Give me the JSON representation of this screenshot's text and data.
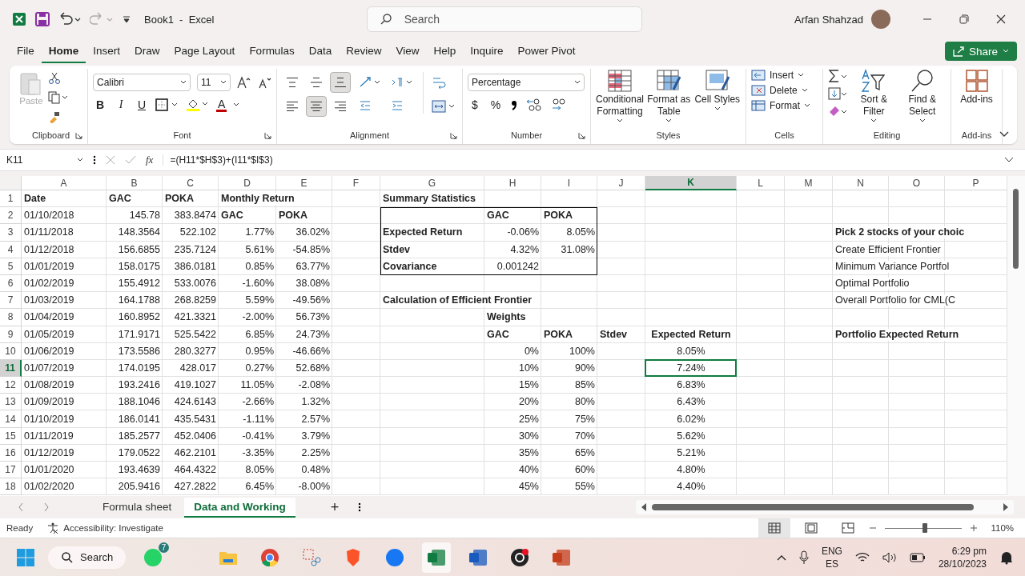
{
  "title_bar": {
    "title": "Book1  -  Excel",
    "search_placeholder": "Search",
    "user": "Arfan Shahzad"
  },
  "menu": [
    {
      "label": "File",
      "selected": false
    },
    {
      "label": "Home",
      "selected": true
    },
    {
      "label": "Insert",
      "selected": false
    },
    {
      "label": "Draw",
      "selected": false
    },
    {
      "label": "Page Layout",
      "selected": false
    },
    {
      "label": "Formulas",
      "selected": false
    },
    {
      "label": "Data",
      "selected": false
    },
    {
      "label": "Review",
      "selected": false
    },
    {
      "label": "View",
      "selected": false
    },
    {
      "label": "Help",
      "selected": false
    },
    {
      "label": "Inquire",
      "selected": false
    },
    {
      "label": "Power Pivot",
      "selected": false
    }
  ],
  "share": {
    "label": "Share"
  },
  "ribbon": {
    "clipboard": {
      "label": "Clipboard",
      "paste": {
        "label": "Paste",
        "disabled": true
      }
    },
    "font": {
      "label": "Font",
      "font_name": "Calibri",
      "font_size": "11",
      "bold": "B",
      "italic": "I",
      "underline": "U",
      "font_color_letter": "A"
    },
    "alignment": {
      "label": "Alignment",
      "buttons": [
        {
          "kind": "top",
          "selected": false
        },
        {
          "kind": "middle",
          "selected": false
        },
        {
          "kind": "bottom",
          "selected": true
        },
        {
          "kind": "left",
          "selected": false
        },
        {
          "kind": "center",
          "selected": true
        },
        {
          "kind": "right",
          "selected": false
        }
      ]
    },
    "number": {
      "label": "Number",
      "format": "Percentage",
      "currency": "$",
      "percent": "%"
    },
    "styles": {
      "label": "Styles",
      "buttons": [
        {
          "kind": "conditional",
          "label": "Conditional Formatting"
        },
        {
          "kind": "table",
          "label": "Format as Table"
        },
        {
          "kind": "cellstyles",
          "label": "Cell Styles"
        }
      ]
    },
    "cells": {
      "label": "Cells",
      "buttons": [
        {
          "kind": "insert",
          "label": "Insert"
        },
        {
          "kind": "delete",
          "label": "Delete"
        },
        {
          "kind": "format",
          "label": "Format"
        }
      ]
    },
    "editing": {
      "label": "Editing",
      "buttons": [
        {
          "kind": "sort",
          "label": "Sort & Filter"
        },
        {
          "kind": "find",
          "label": "Find & Select"
        }
      ]
    },
    "addins": {
      "label": "Add-ins",
      "button": "Add-ins"
    }
  },
  "formula_bar": {
    "name_box": "K11",
    "function_symbol": "fx",
    "formula": "=(H11*$H$3)+(I11*$I$3)"
  },
  "sheet": {
    "columns": [
      {
        "label": "A",
        "selected": false
      },
      {
        "label": "B",
        "selected": false
      },
      {
        "label": "C",
        "selected": false
      },
      {
        "label": "D",
        "selected": false
      },
      {
        "label": "E",
        "selected": false
      },
      {
        "label": "F",
        "selected": false
      },
      {
        "label": "G",
        "selected": false
      },
      {
        "label": "H",
        "selected": false
      },
      {
        "label": "I",
        "selected": false
      },
      {
        "label": "J",
        "selected": false
      },
      {
        "label": "K",
        "selected": true
      },
      {
        "label": "L",
        "selected": false
      },
      {
        "label": "M",
        "selected": false
      },
      {
        "label": "N",
        "selected": false
      },
      {
        "label": "O",
        "selected": false
      },
      {
        "label": "P",
        "selected": false
      }
    ],
    "rows": [
      {
        "number": "1",
        "selected": false,
        "cells": {
          "A": {
            "text": "Date",
            "bold": true,
            "kind": "text"
          },
          "B": {
            "text": "GAC",
            "bold": true,
            "kind": "text"
          },
          "C": {
            "text": "POKA",
            "bold": true,
            "kind": "text"
          },
          "D": {
            "text": "Monthly Return",
            "bold": true,
            "kind": "text"
          },
          "G": {
            "text": "Summary Statistics",
            "bold": true,
            "kind": "text"
          }
        }
      },
      {
        "number": "2",
        "selected": false,
        "cells": {
          "A": {
            "text": "01/10/2018",
            "bold": false,
            "kind": "text"
          },
          "B": {
            "text": "145.78",
            "bold": false,
            "kind": "number"
          },
          "C": {
            "text": "383.8474",
            "bold": false,
            "kind": "number"
          },
          "D": {
            "text": "GAC",
            "bold": true,
            "kind": "text"
          },
          "E": {
            "text": "POKA",
            "bold": true,
            "kind": "text"
          },
          "G": {
            "borders": {
              "top": true,
              "left": true
            }
          },
          "H": {
            "text": "GAC",
            "bold": true,
            "kind": "text",
            "borders": {
              "top": true
            }
          },
          "I": {
            "text": "POKA",
            "bold": true,
            "kind": "text",
            "borders": {
              "top": true,
              "right": true
            }
          }
        }
      },
      {
        "number": "3",
        "selected": false,
        "cells": {
          "A": {
            "text": "01/11/2018",
            "bold": false,
            "kind": "text"
          },
          "B": {
            "text": "148.3564",
            "bold": false,
            "kind": "number"
          },
          "C": {
            "text": "522.102",
            "bold": false,
            "kind": "number"
          },
          "D": {
            "text": "1.77%",
            "bold": false,
            "kind": "number"
          },
          "E": {
            "text": "36.02%",
            "bold": false,
            "kind": "number"
          },
          "G": {
            "text": "Expected Return",
            "bold": true,
            "kind": "text",
            "borders": {
              "left": true
            }
          },
          "H": {
            "text": "-0.06%",
            "bold": false,
            "kind": "number"
          },
          "I": {
            "text": "8.05%",
            "bold": false,
            "kind": "number",
            "borders": {
              "right": true
            }
          },
          "N": {
            "text": "Pick 2 stocks of your choic",
            "bold": true,
            "kind": "text"
          }
        }
      },
      {
        "number": "4",
        "selected": false,
        "cells": {
          "A": {
            "text": "01/12/2018",
            "bold": false,
            "kind": "text"
          },
          "B": {
            "text": "156.6855",
            "bold": false,
            "kind": "number"
          },
          "C": {
            "text": "235.7124",
            "bold": false,
            "kind": "number"
          },
          "D": {
            "text": "5.61%",
            "bold": false,
            "kind": "number"
          },
          "E": {
            "text": "-54.85%",
            "bold": false,
            "kind": "number"
          },
          "G": {
            "text": "Stdev",
            "bold": true,
            "kind": "text",
            "borders": {
              "left": true
            }
          },
          "H": {
            "text": "4.32%",
            "bold": false,
            "kind": "number"
          },
          "I": {
            "text": "31.08%",
            "bold": false,
            "kind": "number",
            "borders": {
              "right": true
            }
          },
          "N": {
            "text": "Create Efficient Frontier",
            "bold": false,
            "kind": "text"
          }
        }
      },
      {
        "number": "5",
        "selected": false,
        "cells": {
          "A": {
            "text": "01/01/2019",
            "bold": false,
            "kind": "text"
          },
          "B": {
            "text": "158.0175",
            "bold": false,
            "kind": "number"
          },
          "C": {
            "text": "386.0181",
            "bold": false,
            "kind": "number"
          },
          "D": {
            "text": "0.85%",
            "bold": false,
            "kind": "number"
          },
          "E": {
            "text": "63.77%",
            "bold": false,
            "kind": "number"
          },
          "G": {
            "text": "Covariance",
            "bold": true,
            "kind": "text",
            "borders": {
              "bottom": true,
              "left": true
            }
          },
          "H": {
            "text": "0.001242",
            "bold": false,
            "kind": "number",
            "borders": {
              "bottom": true
            }
          },
          "I": {
            "borders": {
              "bottom": true,
              "right": true
            }
          },
          "N": {
            "text": "Minimum Variance Portfol",
            "bold": false,
            "kind": "text"
          }
        }
      },
      {
        "number": "6",
        "selected": false,
        "cells": {
          "A": {
            "text": "01/02/2019",
            "bold": false,
            "kind": "text"
          },
          "B": {
            "text": "155.4912",
            "bold": false,
            "kind": "number"
          },
          "C": {
            "text": "533.0076",
            "bold": false,
            "kind": "number"
          },
          "D": {
            "text": "-1.60%",
            "bold": false,
            "kind": "number"
          },
          "E": {
            "text": "38.08%",
            "bold": false,
            "kind": "number"
          },
          "N": {
            "text": "Optimal Portfolio",
            "bold": false,
            "kind": "text"
          }
        }
      },
      {
        "number": "7",
        "selected": false,
        "cells": {
          "A": {
            "text": "01/03/2019",
            "bold": false,
            "kind": "text"
          },
          "B": {
            "text": "164.1788",
            "bold": false,
            "kind": "number"
          },
          "C": {
            "text": "268.8259",
            "bold": false,
            "kind": "number"
          },
          "D": {
            "text": "5.59%",
            "bold": false,
            "kind": "number"
          },
          "E": {
            "text": "-49.56%",
            "bold": false,
            "kind": "number"
          },
          "G": {
            "text": "Calculation of Efficient Frontier",
            "bold": true,
            "kind": "text"
          },
          "N": {
            "text": "Overall Portfolio for CML(C",
            "bold": false,
            "kind": "text"
          }
        }
      },
      {
        "number": "8",
        "selected": false,
        "cells": {
          "A": {
            "text": "01/04/2019",
            "bold": false,
            "kind": "text"
          },
          "B": {
            "text": "160.8952",
            "bold": false,
            "kind": "number"
          },
          "C": {
            "text": "421.3321",
            "bold": false,
            "kind": "number"
          },
          "D": {
            "text": "-2.00%",
            "bold": false,
            "kind": "number"
          },
          "E": {
            "text": "56.73%",
            "bold": false,
            "kind": "number"
          },
          "H": {
            "text": "Weights",
            "bold": true,
            "kind": "text"
          }
        }
      },
      {
        "number": "9",
        "selected": false,
        "cells": {
          "A": {
            "text": "01/05/2019",
            "bold": false,
            "kind": "text"
          },
          "B": {
            "text": "171.9171",
            "bold": false,
            "kind": "number"
          },
          "C": {
            "text": "525.5422",
            "bold": false,
            "kind": "number"
          },
          "D": {
            "text": "6.85%",
            "bold": false,
            "kind": "number"
          },
          "E": {
            "text": "24.73%",
            "bold": false,
            "kind": "number"
          },
          "H": {
            "text": "GAC",
            "bold": true,
            "kind": "text"
          },
          "I": {
            "text": "POKA",
            "bold": true,
            "kind": "text"
          },
          "J": {
            "text": "Stdev",
            "bold": true,
            "kind": "text"
          },
          "K": {
            "text": "Expected Return",
            "bold": true,
            "kind": "centered"
          },
          "N": {
            "text": "Portfolio Expected Return",
            "bold": true,
            "kind": "text"
          }
        }
      },
      {
        "number": "10",
        "selected": false,
        "cells": {
          "A": {
            "text": "01/06/2019",
            "bold": false,
            "kind": "text"
          },
          "B": {
            "text": "173.5586",
            "bold": false,
            "kind": "number"
          },
          "C": {
            "text": "280.3277",
            "bold": false,
            "kind": "number"
          },
          "D": {
            "text": "0.95%",
            "bold": false,
            "kind": "number"
          },
          "E": {
            "text": "-46.66%",
            "bold": false,
            "kind": "number"
          },
          "H": {
            "text": "0%",
            "bold": false,
            "kind": "number"
          },
          "I": {
            "text": "100%",
            "bold": false,
            "kind": "number"
          },
          "K": {
            "text": "8.05%",
            "bold": false,
            "kind": "centered"
          }
        }
      },
      {
        "number": "11",
        "selected": true,
        "cells": {
          "A": {
            "text": "01/07/2019",
            "bold": false,
            "kind": "text"
          },
          "B": {
            "text": "174.0195",
            "bold": false,
            "kind": "number"
          },
          "C": {
            "text": "428.017",
            "bold": false,
            "kind": "number"
          },
          "D": {
            "text": "0.27%",
            "bold": false,
            "kind": "number"
          },
          "E": {
            "text": "52.68%",
            "bold": false,
            "kind": "number"
          },
          "H": {
            "text": "10%",
            "bold": false,
            "kind": "number"
          },
          "I": {
            "text": "90%",
            "bold": false,
            "kind": "number"
          },
          "K": {
            "text": "7.24%",
            "bold": false,
            "kind": "centered"
          }
        }
      },
      {
        "number": "12",
        "selected": false,
        "cells": {
          "A": {
            "text": "01/08/2019",
            "bold": false,
            "kind": "text"
          },
          "B": {
            "text": "193.2416",
            "bold": false,
            "kind": "number"
          },
          "C": {
            "text": "419.1027",
            "bold": false,
            "kind": "number"
          },
          "D": {
            "text": "11.05%",
            "bold": false,
            "kind": "number"
          },
          "E": {
            "text": "-2.08%",
            "bold": false,
            "kind": "number"
          },
          "H": {
            "text": "15%",
            "bold": false,
            "kind": "number"
          },
          "I": {
            "text": "85%",
            "bold": false,
            "kind": "number"
          },
          "K": {
            "text": "6.83%",
            "bold": false,
            "kind": "centered"
          }
        }
      },
      {
        "number": "13",
        "selected": false,
        "cells": {
          "A": {
            "text": "01/09/2019",
            "bold": false,
            "kind": "text"
          },
          "B": {
            "text": "188.1046",
            "bold": false,
            "kind": "number"
          },
          "C": {
            "text": "424.6143",
            "bold": false,
            "kind": "number"
          },
          "D": {
            "text": "-2.66%",
            "bold": false,
            "kind": "number"
          },
          "E": {
            "text": "1.32%",
            "bold": false,
            "kind": "number"
          },
          "H": {
            "text": "20%",
            "bold": false,
            "kind": "number"
          },
          "I": {
            "text": "80%",
            "bold": false,
            "kind": "number"
          },
          "K": {
            "text": "6.43%",
            "bold": false,
            "kind": "centered"
          }
        }
      },
      {
        "number": "14",
        "selected": false,
        "cells": {
          "A": {
            "text": "01/10/2019",
            "bold": false,
            "kind": "text"
          },
          "B": {
            "text": "186.0141",
            "bold": false,
            "kind": "number"
          },
          "C": {
            "text": "435.5431",
            "bold": false,
            "kind": "number"
          },
          "D": {
            "text": "-1.11%",
            "bold": false,
            "kind": "number"
          },
          "E": {
            "text": "2.57%",
            "bold": false,
            "kind": "number"
          },
          "H": {
            "text": "25%",
            "bold": false,
            "kind": "number"
          },
          "I": {
            "text": "75%",
            "bold": false,
            "kind": "number"
          },
          "K": {
            "text": "6.02%",
            "bold": false,
            "kind": "centered"
          }
        }
      },
      {
        "number": "15",
        "selected": false,
        "cells": {
          "A": {
            "text": "01/11/2019",
            "bold": false,
            "kind": "text"
          },
          "B": {
            "text": "185.2577",
            "bold": false,
            "kind": "number"
          },
          "C": {
            "text": "452.0406",
            "bold": false,
            "kind": "number"
          },
          "D": {
            "text": "-0.41%",
            "bold": false,
            "kind": "number"
          },
          "E": {
            "text": "3.79%",
            "bold": false,
            "kind": "number"
          },
          "H": {
            "text": "30%",
            "bold": false,
            "kind": "number"
          },
          "I": {
            "text": "70%",
            "bold": false,
            "kind": "number"
          },
          "K": {
            "text": "5.62%",
            "bold": false,
            "kind": "centered"
          }
        }
      },
      {
        "number": "16",
        "selected": false,
        "cells": {
          "A": {
            "text": "01/12/2019",
            "bold": false,
            "kind": "text"
          },
          "B": {
            "text": "179.0522",
            "bold": false,
            "kind": "number"
          },
          "C": {
            "text": "462.2101",
            "bold": false,
            "kind": "number"
          },
          "D": {
            "text": "-3.35%",
            "bold": false,
            "kind": "number"
          },
          "E": {
            "text": "2.25%",
            "bold": false,
            "kind": "number"
          },
          "H": {
            "text": "35%",
            "bold": false,
            "kind": "number"
          },
          "I": {
            "text": "65%",
            "bold": false,
            "kind": "number"
          },
          "K": {
            "text": "5.21%",
            "bold": false,
            "kind": "centered"
          }
        }
      },
      {
        "number": "17",
        "selected": false,
        "cells": {
          "A": {
            "text": "01/01/2020",
            "bold": false,
            "kind": "text"
          },
          "B": {
            "text": "193.4639",
            "bold": false,
            "kind": "number"
          },
          "C": {
            "text": "464.4322",
            "bold": false,
            "kind": "number"
          },
          "D": {
            "text": "8.05%",
            "bold": false,
            "kind": "number"
          },
          "E": {
            "text": "0.48%",
            "bold": false,
            "kind": "number"
          },
          "H": {
            "text": "40%",
            "bold": false,
            "kind": "number"
          },
          "I": {
            "text": "60%",
            "bold": false,
            "kind": "number"
          },
          "K": {
            "text": "4.80%",
            "bold": false,
            "kind": "centered"
          }
        }
      },
      {
        "number": "18",
        "selected": false,
        "cells": {
          "A": {
            "text": "01/02/2020",
            "bold": false,
            "kind": "text"
          },
          "B": {
            "text": "205.9416",
            "bold": false,
            "kind": "number"
          },
          "C": {
            "text": "427.2822",
            "bold": false,
            "kind": "number"
          },
          "D": {
            "text": "6.45%",
            "bold": false,
            "kind": "number"
          },
          "E": {
            "text": "-8.00%",
            "bold": false,
            "kind": "number"
          },
          "H": {
            "text": "45%",
            "bold": false,
            "kind": "number"
          },
          "I": {
            "text": "55%",
            "bold": false,
            "kind": "number"
          },
          "K": {
            "text": "4.40%",
            "bold": false,
            "kind": "centered"
          }
        }
      }
    ]
  },
  "sheet_tabs": [
    {
      "label": "Formula sheet",
      "selected": false
    },
    {
      "label": "Data and Working",
      "selected": true
    }
  ],
  "add_sheet": "+",
  "status_bar": {
    "ready": "Ready",
    "accessibility": "Accessibility: Investigate",
    "views": [
      {
        "kind": "normal",
        "selected": true
      },
      {
        "kind": "page-layout",
        "selected": false
      },
      {
        "kind": "page-break",
        "selected": false
      }
    ],
    "zoom": {
      "level": 0.52,
      "reading": "110%"
    }
  },
  "taskbar": {
    "search": "Search",
    "apps": [
      {
        "kind": "whatsapp",
        "badge": "7",
        "selected": false
      },
      {
        "kind": "folder",
        "selected": false
      },
      {
        "kind": "chrome",
        "selected": false
      },
      {
        "kind": "snip",
        "selected": false
      },
      {
        "kind": "brave",
        "selected": false
      },
      {
        "kind": "facebook",
        "selected": false
      },
      {
        "kind": "excel",
        "selected": true
      },
      {
        "kind": "word",
        "selected": false
      },
      {
        "kind": "obs",
        "selected": false
      },
      {
        "kind": "powerpoint",
        "selected": false
      }
    ],
    "language": "ENG",
    "layout": "ES",
    "time": "6:29 pm",
    "date": "28/10/2023"
  }
}
